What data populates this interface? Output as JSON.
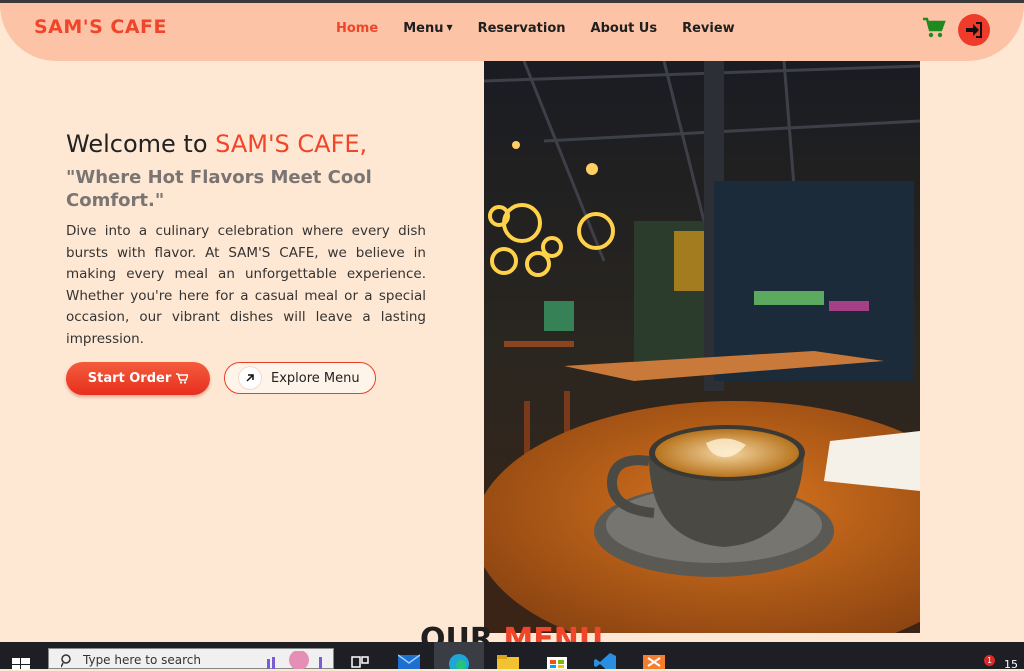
{
  "brand": {
    "name": "SAM'S CAFE"
  },
  "nav": {
    "items": [
      {
        "label": "Home",
        "active": true
      },
      {
        "label": "Menu",
        "dropdown": true
      },
      {
        "label": "Reservation"
      },
      {
        "label": "About Us"
      },
      {
        "label": "Review"
      }
    ],
    "cart_icon": "cart-icon",
    "login_icon": "sign-in-icon"
  },
  "hero": {
    "welcome_prefix": "Welcome to ",
    "welcome_accent": "SAM'S CAFE,",
    "tagline": "\"Where Hot Flavors Meet Cool Comfort.\"",
    "description": "Dive into a culinary celebration where every dish bursts with flavor. At SAM'S CAFE, we believe in making every meal an unforgettable experience. Whether you're here for a casual meal or a special occasion, our vibrant dishes will leave a lasting impression.",
    "start_order_label": "Start Order",
    "explore_menu_label": "Explore Menu",
    "image_icon": "cafe-coffee-photo"
  },
  "section": {
    "title_prefix": "OUR ",
    "title_accent": "MENU"
  },
  "taskbar": {
    "search_placeholder": "Type here to search",
    "notification_count": "1",
    "clock_partial": "15"
  },
  "colors": {
    "accent": "#f0452a",
    "navbar": "#fcc3a6",
    "page_bg": "#ffe8d3",
    "cart_green": "#1f8a1f"
  }
}
